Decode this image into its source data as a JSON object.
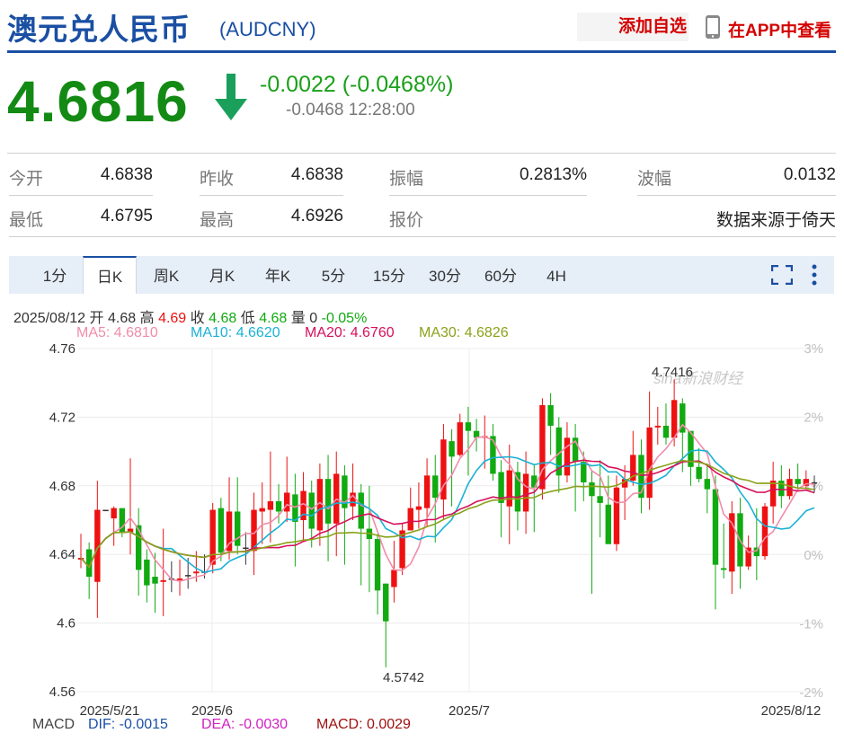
{
  "header": {
    "title": "澳元兑人民币",
    "code": "(AUDCNY)",
    "add_watchlist": "添加自选",
    "view_in_app": "在APP中查看"
  },
  "quote": {
    "price": "4.6816",
    "change": "-0.0022 (-0.0468%)",
    "sub_change": "-0.0468",
    "time": "12:28:00",
    "trend": "down"
  },
  "stats": {
    "open_label": "今开",
    "open_value": "4.6838",
    "prev_close_label": "昨收",
    "prev_close_value": "4.6838",
    "amplitude_label": "振幅",
    "amplitude_value": "0.2813%",
    "wave_label": "波幅",
    "wave_value": "0.0132",
    "low_label": "最低",
    "low_value": "4.6795",
    "high_label": "最高",
    "high_value": "4.6926",
    "quote_label": "报价",
    "source_text": "数据来源于倚天"
  },
  "tabs": [
    {
      "label": "1分",
      "active": false
    },
    {
      "label": "日K",
      "active": true
    },
    {
      "label": "周K",
      "active": false
    },
    {
      "label": "月K",
      "active": false
    },
    {
      "label": "年K",
      "active": false
    },
    {
      "label": "5分",
      "active": false
    },
    {
      "label": "15分",
      "active": false
    },
    {
      "label": "30分",
      "active": false
    },
    {
      "label": "60分",
      "active": false
    },
    {
      "label": "4H",
      "active": false
    }
  ],
  "ohlc_info": {
    "date": "2025/08/12",
    "open_label": "开",
    "open": "4.68",
    "high_label": "高",
    "high": "4.69",
    "close_label": "收",
    "close": "4.68",
    "low_label": "低",
    "low": "4.68",
    "vol_label": "量",
    "vol": "0",
    "change": "-0.05%"
  },
  "ma_info": [
    {
      "label": "MA5: 4.6810",
      "color": "#f08caa"
    },
    {
      "label": "MA10: 4.6620",
      "color": "#1ab1d4"
    },
    {
      "label": "MA20: 4.6760",
      "color": "#d6105a"
    },
    {
      "label": "MA30: 4.6826",
      "color": "#8aa21a"
    }
  ],
  "macd_info": {
    "title": "MACD",
    "dif": "DIF: -0.0015",
    "dea": "DEA: -0.0030",
    "macd": "MACD: 0.0029"
  },
  "watermark": "sina新浪财经",
  "colors": {
    "up": "#ee1111",
    "down": "#11aa11",
    "accent": "#1a4fa3"
  },
  "chart_data": {
    "type": "candlestick",
    "y_ticks": [
      "4.76",
      "4.72",
      "4.68",
      "4.64",
      "4.6",
      "4.56"
    ],
    "pct_ticks": [
      "3%",
      "2%",
      "1%",
      "0%",
      "-1%",
      "-2%"
    ],
    "x_ticks": [
      "2025/5/21",
      "2025/6",
      "2025/7",
      "2025/8/12"
    ],
    "ylim": [
      4.56,
      4.76
    ],
    "annotations": [
      {
        "label": "4.7416",
        "price": 4.7416
      },
      {
        "label": "4.5742",
        "price": 4.5742
      }
    ],
    "candles": [
      [
        4.637,
        4.638,
        4.652,
        4.632
      ],
      [
        4.643,
        4.627,
        4.647,
        4.614
      ],
      [
        4.624,
        4.666,
        4.683,
        4.603
      ],
      [
        4.666,
        4.666,
        4.666,
        4.666
      ],
      [
        4.661,
        4.667,
        4.668,
        4.645
      ],
      [
        4.667,
        4.653,
        4.664,
        4.65
      ],
      [
        4.653,
        4.655,
        4.696,
        4.64
      ],
      [
        4.657,
        4.631,
        4.667,
        4.616
      ],
      [
        4.637,
        4.622,
        4.643,
        4.612
      ],
      [
        4.627,
        4.623,
        4.641,
        4.606
      ],
      [
        4.624,
        4.625,
        4.655,
        4.604
      ],
      [
        4.626,
        4.626,
        4.636,
        4.618
      ],
      [
        4.625,
        4.626,
        4.637,
        4.616
      ],
      [
        4.628,
        4.628,
        4.638,
        4.62
      ],
      [
        4.629,
        4.63,
        4.642,
        4.624
      ],
      [
        4.63,
        4.63,
        4.64,
        4.626
      ],
      [
        4.634,
        4.666,
        4.67,
        4.629
      ],
      [
        4.667,
        4.641,
        4.673,
        4.636
      ],
      [
        4.642,
        4.665,
        4.685,
        4.637
      ],
      [
        4.665,
        4.645,
        4.685,
        4.64
      ],
      [
        4.644,
        4.644,
        4.653,
        4.634
      ],
      [
        4.642,
        4.666,
        4.676,
        4.628
      ],
      [
        4.665,
        4.667,
        4.682,
        4.646
      ],
      [
        4.666,
        4.671,
        4.7,
        4.647
      ],
      [
        4.671,
        4.665,
        4.681,
        4.658
      ],
      [
        4.665,
        4.676,
        4.697,
        4.659
      ],
      [
        4.675,
        4.659,
        4.687,
        4.633
      ],
      [
        4.66,
        4.677,
        4.688,
        4.648
      ],
      [
        4.676,
        4.655,
        4.683,
        4.644
      ],
      [
        4.654,
        4.684,
        4.693,
        4.645
      ],
      [
        4.684,
        4.658,
        4.698,
        4.636
      ],
      [
        4.658,
        4.687,
        4.7,
        4.639
      ],
      [
        4.686,
        4.667,
        4.692,
        4.634
      ],
      [
        4.668,
        4.676,
        4.693,
        4.66
      ],
      [
        4.676,
        4.655,
        4.681,
        4.622
      ],
      [
        4.655,
        4.649,
        4.68,
        4.618
      ],
      [
        4.649,
        4.619,
        4.652,
        4.605
      ],
      [
        4.623,
        4.601,
        4.623,
        4.5742
      ],
      [
        4.621,
        4.631,
        4.648,
        4.612
      ],
      [
        4.632,
        4.654,
        4.658,
        4.628
      ],
      [
        4.654,
        4.667,
        4.679,
        4.655
      ],
      [
        4.666,
        4.668,
        4.682,
        4.655
      ],
      [
        4.667,
        4.686,
        4.696,
        4.656
      ],
      [
        4.686,
        4.673,
        4.698,
        4.647
      ],
      [
        4.672,
        4.707,
        4.716,
        4.66
      ],
      [
        4.706,
        4.697,
        4.713,
        4.668
      ],
      [
        4.698,
        4.717,
        4.722,
        4.697
      ],
      [
        4.717,
        4.712,
        4.726,
        4.686
      ],
      [
        4.712,
        4.708,
        4.719,
        4.7
      ],
      [
        4.708,
        4.709,
        4.721,
        4.69
      ],
      [
        4.709,
        4.687,
        4.716,
        4.683
      ],
      [
        4.688,
        4.67,
        4.695,
        4.65
      ],
      [
        4.668,
        4.689,
        4.704,
        4.646
      ],
      [
        4.688,
        4.665,
        4.694,
        4.654
      ],
      [
        4.665,
        4.687,
        4.7,
        4.652
      ],
      [
        4.686,
        4.679,
        4.692,
        4.653
      ],
      [
        4.678,
        4.727,
        4.731,
        4.672
      ],
      [
        4.727,
        4.715,
        4.734,
        4.698
      ],
      [
        4.714,
        4.686,
        4.72,
        4.676
      ],
      [
        4.686,
        4.708,
        4.717,
        4.682
      ],
      [
        4.708,
        4.694,
        4.716,
        4.665
      ],
      [
        4.694,
        4.682,
        4.7,
        4.671
      ],
      [
        4.682,
        4.674,
        4.689,
        4.617
      ],
      [
        4.674,
        4.67,
        4.695,
        4.65
      ],
      [
        4.669,
        4.646,
        4.686,
        4.647
      ],
      [
        4.646,
        4.679,
        4.686,
        4.642
      ],
      [
        4.679,
        4.684,
        4.692,
        4.66
      ],
      [
        4.683,
        4.698,
        4.712,
        4.68
      ],
      [
        4.698,
        4.673,
        4.707,
        4.664
      ],
      [
        4.673,
        4.714,
        4.735,
        4.666
      ],
      [
        4.714,
        4.715,
        4.726,
        4.704
      ],
      [
        4.715,
        4.708,
        4.728,
        4.704
      ],
      [
        4.708,
        4.73,
        4.742,
        4.703
      ],
      [
        4.728,
        4.711,
        4.731,
        4.688
      ],
      [
        4.712,
        4.691,
        4.7,
        4.68
      ],
      [
        4.691,
        4.684,
        4.702,
        4.682
      ],
      [
        4.684,
        4.678,
        4.693,
        4.664
      ],
      [
        4.678,
        4.634,
        4.686,
        4.608
      ],
      [
        4.632,
        4.631,
        4.658,
        4.626
      ],
      [
        4.63,
        4.664,
        4.671,
        4.617
      ],
      [
        4.664,
        4.633,
        4.673,
        4.62
      ],
      [
        4.633,
        4.644,
        4.651,
        4.631
      ],
      [
        4.644,
        4.639,
        4.667,
        4.625
      ],
      [
        4.639,
        4.668,
        4.67,
        4.637
      ],
      [
        4.668,
        4.683,
        4.694,
        4.658
      ],
      [
        4.683,
        4.674,
        4.692,
        4.667
      ],
      [
        4.674,
        4.684,
        4.69,
        4.672
      ],
      [
        4.684,
        4.681,
        4.693,
        4.679
      ],
      [
        4.68,
        4.684,
        4.689,
        4.678
      ],
      [
        4.682,
        4.682,
        4.686,
        4.676
      ]
    ]
  }
}
